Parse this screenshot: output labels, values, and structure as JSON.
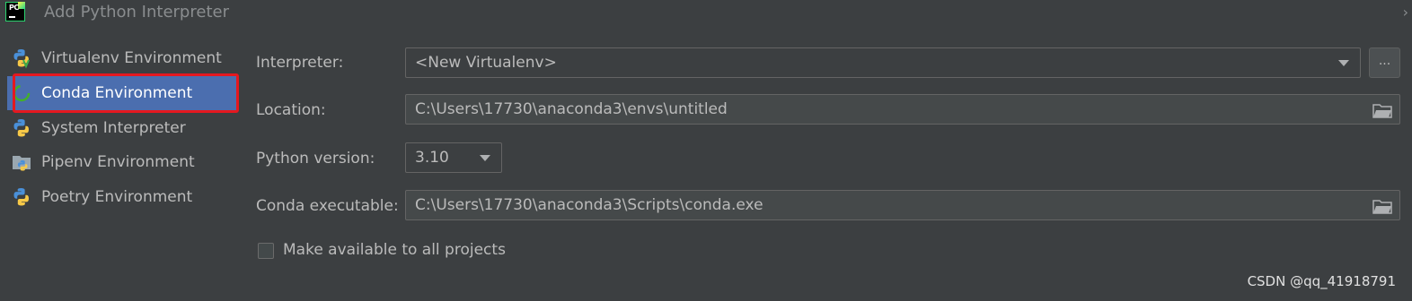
{
  "window": {
    "title": "Add Python Interpreter",
    "app_icon": "pycharm-logo",
    "app_icon_text": "PC"
  },
  "sidebar": {
    "items": [
      {
        "label": "Virtualenv Environment",
        "icon": "python-virtualenv-icon"
      },
      {
        "label": "Conda Environment",
        "icon": "conda-icon",
        "selected": true
      },
      {
        "label": "System Interpreter",
        "icon": "python-icon"
      },
      {
        "label": "Pipenv Environment",
        "icon": "pipenv-folder-icon"
      },
      {
        "label": "Poetry Environment",
        "icon": "python-poetry-icon"
      }
    ],
    "highlight_color": "#e5181f",
    "selected_color": "#4b6eaf"
  },
  "form": {
    "interpreter": {
      "label": "Interpreter:",
      "value": "<New Virtualenv>",
      "browse_label": "..."
    },
    "location": {
      "label": "Location:",
      "value": "C:\\Users\\17730\\anaconda3\\envs\\untitled"
    },
    "python_version": {
      "label": "Python version:",
      "value": "3.10"
    },
    "conda_executable": {
      "label": "Conda executable:",
      "value": "C:\\Users\\17730\\anaconda3\\Scripts\\conda.exe"
    },
    "make_available": {
      "label": "Make available to all projects",
      "checked": false
    }
  },
  "watermark": "CSDN @qq_41918791"
}
